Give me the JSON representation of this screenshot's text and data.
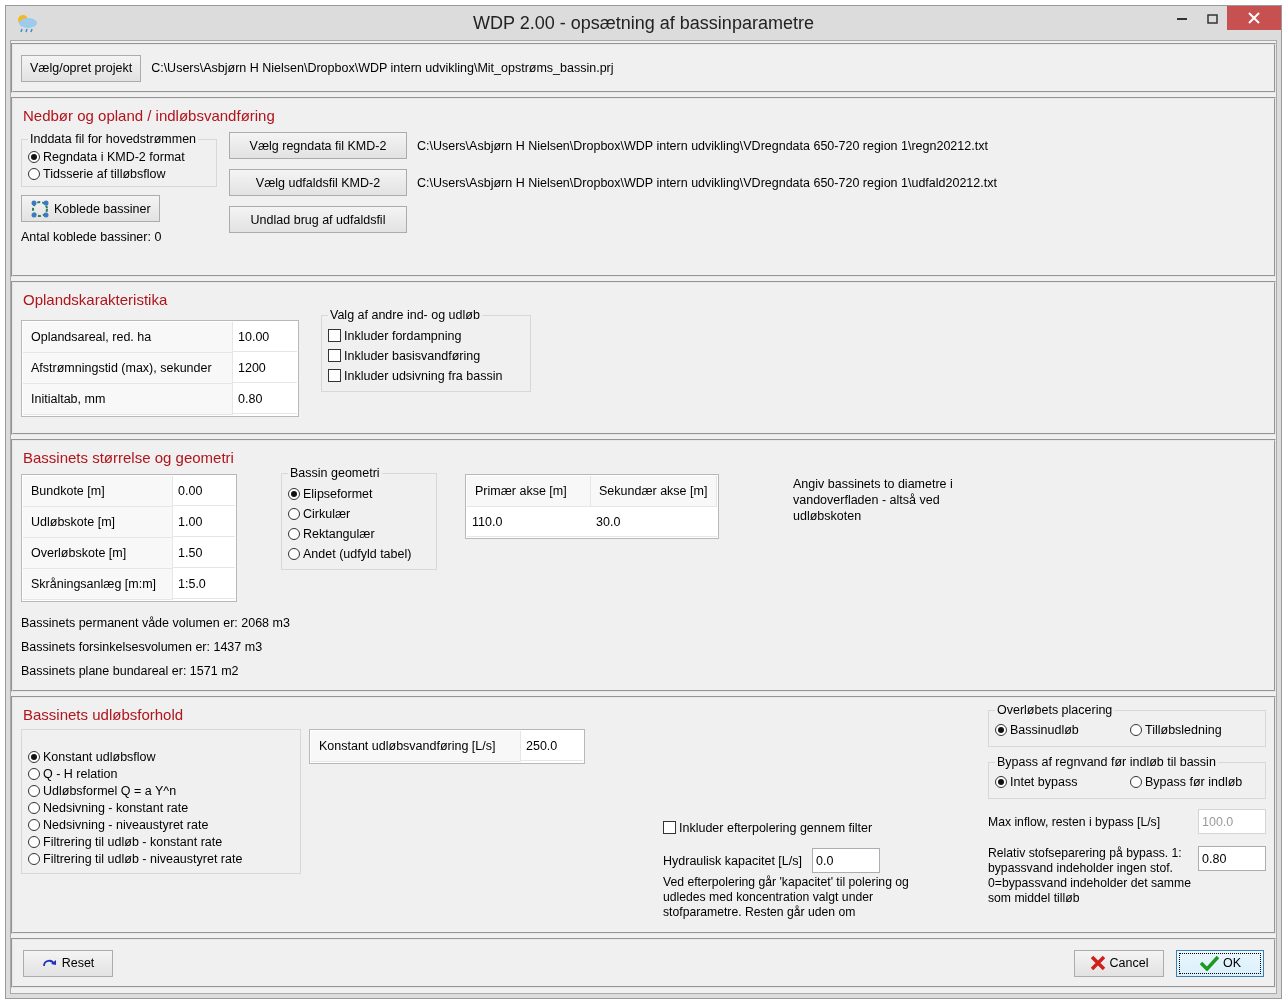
{
  "window": {
    "title": "WDP 2.00 - opsætning af bassinparametre"
  },
  "project": {
    "button": "Vælg/opret projekt",
    "path": "C:\\Users\\Asbjørn H Nielsen\\Dropbox\\WDP intern udvikling\\Mit_opstrøms_bassin.prj"
  },
  "precipitation": {
    "heading": "Nedbør og opland / indløbsvandføring",
    "input_group": {
      "title": "Inddata fil for hovedstrømmen",
      "options": [
        {
          "label": "Regndata i KMD-2 format",
          "selected": true
        },
        {
          "label": "Tidsserie af tilløbsflow",
          "selected": false
        }
      ]
    },
    "link_button": "Koblede bassiner",
    "linked_count": "Antal koblede bassiner: 0",
    "file_buttons": [
      {
        "label": "Vælg regndata fil KMD-2",
        "path": "C:\\Users\\Asbjørn H Nielsen\\Dropbox\\WDP intern udvikling\\VDregndata 650-720 region 1\\regn20212.txt"
      },
      {
        "label": "Vælg udfaldsfil KMD-2",
        "path": "C:\\Users\\Asbjørn H Nielsen\\Dropbox\\WDP intern udvikling\\VDregndata 650-720 region 1\\udfald20212.txt"
      },
      {
        "label": "Undlad brug af udfaldsfil"
      }
    ]
  },
  "catchment": {
    "heading": "Oplandskarakteristika",
    "parameters": [
      {
        "label": "Oplandsareal, red. ha",
        "value": "10.00"
      },
      {
        "label": "Afstrømningstid (max), sekunder",
        "value": "1200"
      },
      {
        "label": "Initialtab, mm",
        "value": "0.80"
      }
    ],
    "other_group": {
      "title": "Valg af andre ind- og udløb",
      "options": [
        {
          "label": "Inkluder fordampning",
          "checked": false
        },
        {
          "label": "Inkluder basisvandføring",
          "checked": false
        },
        {
          "label": "Inkluder udsivning fra bassin",
          "checked": false
        }
      ]
    }
  },
  "geometry": {
    "heading": "Bassinets størrelse og geometri",
    "parameters": [
      {
        "label": "Bundkote [m]",
        "value": "0.00"
      },
      {
        "label": "Udløbskote [m]",
        "value": "1.00"
      },
      {
        "label": "Overløbskote [m]",
        "value": "1.50"
      },
      {
        "label": "Skråningsanlæg [m:m]",
        "value": "1:5.0"
      }
    ],
    "shape_group": {
      "title": "Bassin geometri",
      "options": [
        {
          "label": "Elipseformet",
          "selected": true
        },
        {
          "label": "Cirkulær",
          "selected": false
        },
        {
          "label": "Rektangulær",
          "selected": false
        },
        {
          "label": "Andet (udfyld tabel)",
          "selected": false
        }
      ]
    },
    "axes": {
      "columns": [
        "Primær akse [m]",
        "Sekundær akse [m]"
      ],
      "values": [
        "110.0",
        "30.0"
      ]
    },
    "note": "Angiv bassinets to diametre i vandoverfladen - altså ved udløbskoten",
    "results": [
      "Bassinets permanent våde volumen er: 2068 m3",
      "Bassinets forsinkelsesvolumen er: 1437 m3",
      "Bassinets plane bundareal er: 1571 m2"
    ]
  },
  "outlet": {
    "heading": "Bassinets udløbsforhold",
    "modes": [
      {
        "label": "Konstant udløbsflow",
        "selected": true
      },
      {
        "label": "Q - H relation",
        "selected": false
      },
      {
        "label": "Udløbsformel Q = a Y^n",
        "selected": false
      },
      {
        "label": "Nedsivning - konstant rate",
        "selected": false
      },
      {
        "label": "Nedsivning - niveaustyret rate",
        "selected": false
      },
      {
        "label": "Filtrering til udløb - konstant rate",
        "selected": false
      },
      {
        "label": "Filtrering til udløb - niveaustyret rate",
        "selected": false
      }
    ],
    "constant_field": {
      "label": "Konstant udløbsvandføring [L/s]",
      "value": "250.0"
    },
    "filter": {
      "label": "Inkluder efterpolering gennem filter",
      "checked": false
    },
    "hydraulic": {
      "label": "Hydraulisk kapacitet [L/s]",
      "value": "0.0"
    },
    "filter_note": "Ved efterpolering går 'kapacitet' til polering og udledes med koncentration valgt under stofparametre. Resten går uden om",
    "overflow_group": {
      "title": "Overløbets placering",
      "options": [
        {
          "label": "Bassinudløb",
          "selected": true
        },
        {
          "label": "Tilløbsledning",
          "selected": false
        }
      ]
    },
    "bypass_group": {
      "title": "Bypass af regnvand før indløb til bassin",
      "options": [
        {
          "label": "Intet bypass",
          "selected": true
        },
        {
          "label": "Bypass før indløb",
          "selected": false
        }
      ]
    },
    "max_inflow": {
      "label": "Max inflow, resten i bypass [L/s]",
      "value": "100.0",
      "disabled": true
    },
    "separation": {
      "label": "Relativ stofseparering på bypass. 1: bypassvand indeholder ingen stof. 0=bypassvand indeholder det samme som middel tilløb",
      "value": "0.80"
    }
  },
  "buttons": {
    "reset": "Reset",
    "cancel": "Cancel",
    "ok": "OK"
  }
}
